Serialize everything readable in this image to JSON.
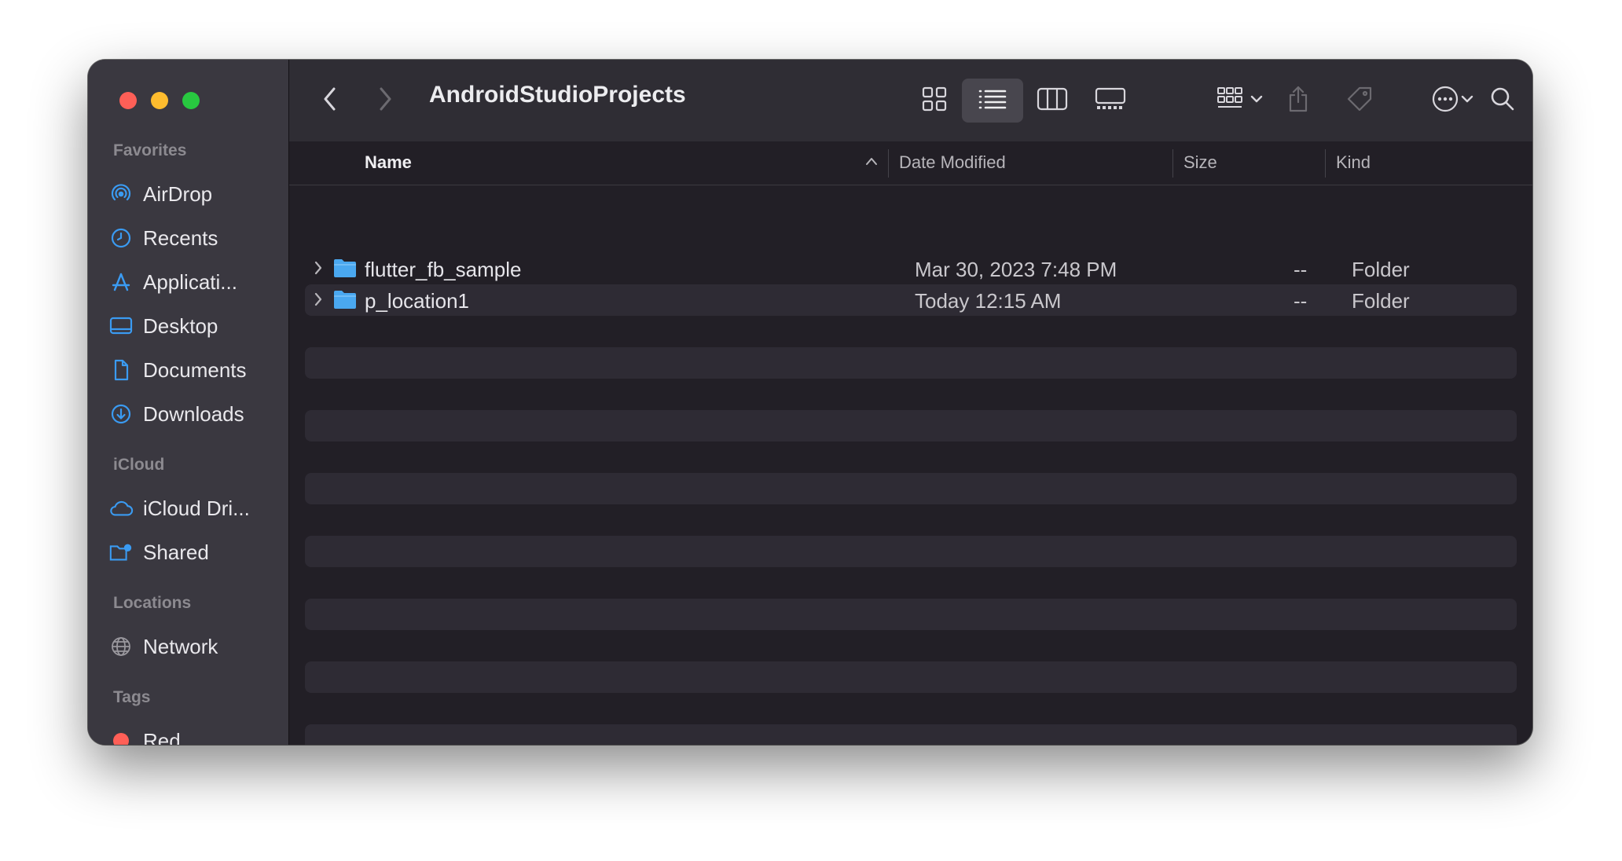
{
  "window": {
    "title": "AndroidStudioProjects"
  },
  "sidebar": {
    "sections": [
      {
        "label": "Favorites"
      },
      {
        "label": "iCloud"
      },
      {
        "label": "Locations"
      },
      {
        "label": "Tags"
      }
    ],
    "favorites": [
      {
        "label": "AirDrop",
        "icon": "airdrop-icon"
      },
      {
        "label": "Recents",
        "icon": "clock-icon"
      },
      {
        "label": "Applicati...",
        "icon": "applications-icon"
      },
      {
        "label": "Desktop",
        "icon": "desktop-icon"
      },
      {
        "label": "Documents",
        "icon": "document-icon"
      },
      {
        "label": "Downloads",
        "icon": "download-icon"
      }
    ],
    "icloud": [
      {
        "label": "iCloud Dri...",
        "icon": "cloud-icon"
      },
      {
        "label": "Shared",
        "icon": "shared-folder-icon"
      }
    ],
    "locations": [
      {
        "label": "Network",
        "icon": "globe-icon"
      }
    ],
    "tags": [
      {
        "label": "Red",
        "color": "#ff5f57"
      }
    ]
  },
  "toolbar": {
    "back_icon": "chevron-left-icon",
    "forward_icon": "chevron-right-icon",
    "view_modes": [
      "icon-view-icon",
      "list-view-icon",
      "column-view-icon",
      "gallery-view-icon"
    ],
    "active_view": "list-view-icon",
    "group_icon": "group-by-icon",
    "share_icon": "share-icon",
    "tag_icon": "tag-icon",
    "more_icon": "more-icon",
    "search_icon": "search-icon"
  },
  "columns": {
    "name": "Name",
    "date": "Date Modified",
    "size": "Size",
    "kind": "Kind"
  },
  "files": [
    {
      "name": "flutter_fb_sample",
      "date": "Mar 30, 2023 7:48 PM",
      "size": "--",
      "kind": "Folder"
    },
    {
      "name": "p_location1",
      "date": "Today 12:15 AM",
      "size": "--",
      "kind": "Folder"
    }
  ],
  "colors": {
    "accent": "#3a9bf2",
    "folder": "#4aa8f0"
  }
}
